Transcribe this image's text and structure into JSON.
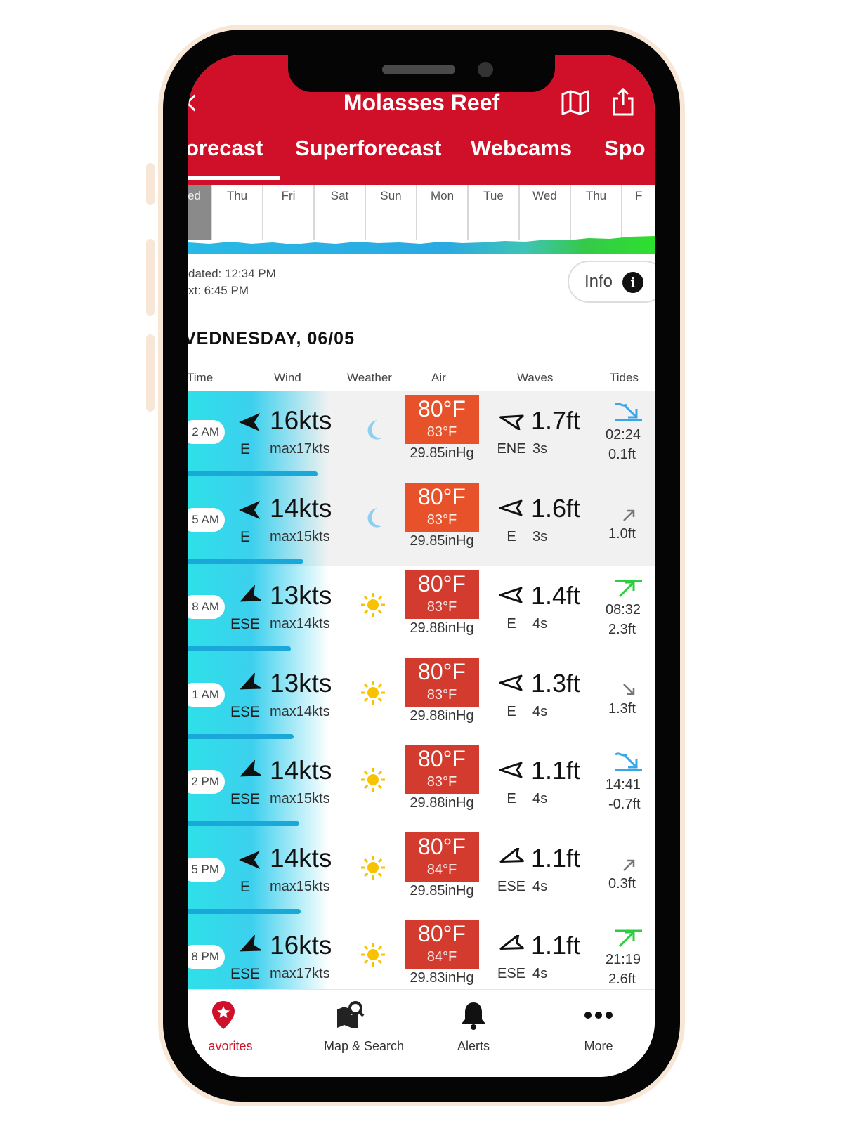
{
  "colors": {
    "brand_red": "#d01028",
    "air_orange": "#e8522a",
    "air_red": "#d23b2e",
    "wind_cyan": "#2ee0e8",
    "tide_blue": "#3aa6e6",
    "tide_green": "#2ecc40"
  },
  "header": {
    "title": "Molasses Reef",
    "back_icon": "chevron-left-icon",
    "map_icon": "map-icon",
    "share_icon": "share-icon",
    "tabs": [
      "orecast",
      "Superforecast",
      "Webcams",
      "Spo"
    ]
  },
  "days": [
    "ed",
    "Thu",
    "Fri",
    "Sat",
    "Sun",
    "Mon",
    "Tue",
    "Wed",
    "Thu",
    "F"
  ],
  "status": {
    "updated": "dated: 12:34 PM",
    "next": "xt: 6:45 PM",
    "info_label": "Info"
  },
  "forecast": {
    "heading": "VEDNESDAY, 06/05",
    "columns": [
      "Time",
      "Wind",
      "Weather",
      "Air",
      "Waves",
      "Tides"
    ],
    "rows": [
      {
        "time": "2 AM",
        "wind_speed": "16kts",
        "wind_dir": "E",
        "wind_max": "max17kts",
        "weather_icon": "moon-icon",
        "air": "80°F",
        "feels": "83°F",
        "pressure": "29.85inHg",
        "wave_height": "1.7ft",
        "wave_dir": "ENE",
        "wave_period": "3s",
        "tide_icon": "tide-low-icon",
        "tide_time": "02:24",
        "tide_height": "0.1ft"
      },
      {
        "time": "5 AM",
        "wind_speed": "14kts",
        "wind_dir": "E",
        "wind_max": "max15kts",
        "weather_icon": "moon-icon",
        "air": "80°F",
        "feels": "83°F",
        "pressure": "29.85inHg",
        "wave_height": "1.6ft",
        "wave_dir": "E",
        "wave_period": "3s",
        "tide_icon": "tide-rising-icon",
        "tide_time": "",
        "tide_height": "1.0ft"
      },
      {
        "time": "8 AM",
        "wind_speed": "13kts",
        "wind_dir": "ESE",
        "wind_max": "max14kts",
        "weather_icon": "sun-icon",
        "air": "80°F",
        "feels": "83°F",
        "pressure": "29.88inHg",
        "wave_height": "1.4ft",
        "wave_dir": "E",
        "wave_period": "4s",
        "tide_icon": "tide-high-icon",
        "tide_time": "08:32",
        "tide_height": "2.3ft"
      },
      {
        "time": "1 AM",
        "wind_speed": "13kts",
        "wind_dir": "ESE",
        "wind_max": "max14kts",
        "weather_icon": "sun-icon",
        "air": "80°F",
        "feels": "83°F",
        "pressure": "29.88inHg",
        "wave_height": "1.3ft",
        "wave_dir": "E",
        "wave_period": "4s",
        "tide_icon": "tide-falling-icon",
        "tide_time": "",
        "tide_height": "1.3ft"
      },
      {
        "time": "2 PM",
        "wind_speed": "14kts",
        "wind_dir": "ESE",
        "wind_max": "max15kts",
        "weather_icon": "sun-icon",
        "air": "80°F",
        "feels": "83°F",
        "pressure": "29.88inHg",
        "wave_height": "1.1ft",
        "wave_dir": "E",
        "wave_period": "4s",
        "tide_icon": "tide-low-icon",
        "tide_time": "14:41",
        "tide_height": "-0.7ft"
      },
      {
        "time": "5 PM",
        "wind_speed": "14kts",
        "wind_dir": "E",
        "wind_max": "max15kts",
        "weather_icon": "sun-icon",
        "air": "80°F",
        "feels": "84°F",
        "pressure": "29.85inHg",
        "wave_height": "1.1ft",
        "wave_dir": "ESE",
        "wave_period": "4s",
        "tide_icon": "tide-rising-icon",
        "tide_time": "",
        "tide_height": "0.3ft"
      },
      {
        "time": "8 PM",
        "wind_speed": "16kts",
        "wind_dir": "ESE",
        "wind_max": "max17kts",
        "weather_icon": "sun-icon",
        "air": "80°F",
        "feels": "84°F",
        "pressure": "29.83inHg",
        "wave_height": "1.1ft",
        "wave_dir": "ESE",
        "wave_period": "4s",
        "tide_icon": "tide-high-icon",
        "tide_time": "21:19",
        "tide_height": "2.6ft"
      }
    ]
  },
  "tabbar": [
    {
      "label": "avorites",
      "icon": "favorites-pin-icon",
      "active": true
    },
    {
      "label": "Map & Search",
      "icon": "map-search-icon",
      "active": false
    },
    {
      "label": "Alerts",
      "icon": "bell-icon",
      "active": false
    },
    {
      "label": "More",
      "icon": "more-dots-icon",
      "active": false
    }
  ]
}
